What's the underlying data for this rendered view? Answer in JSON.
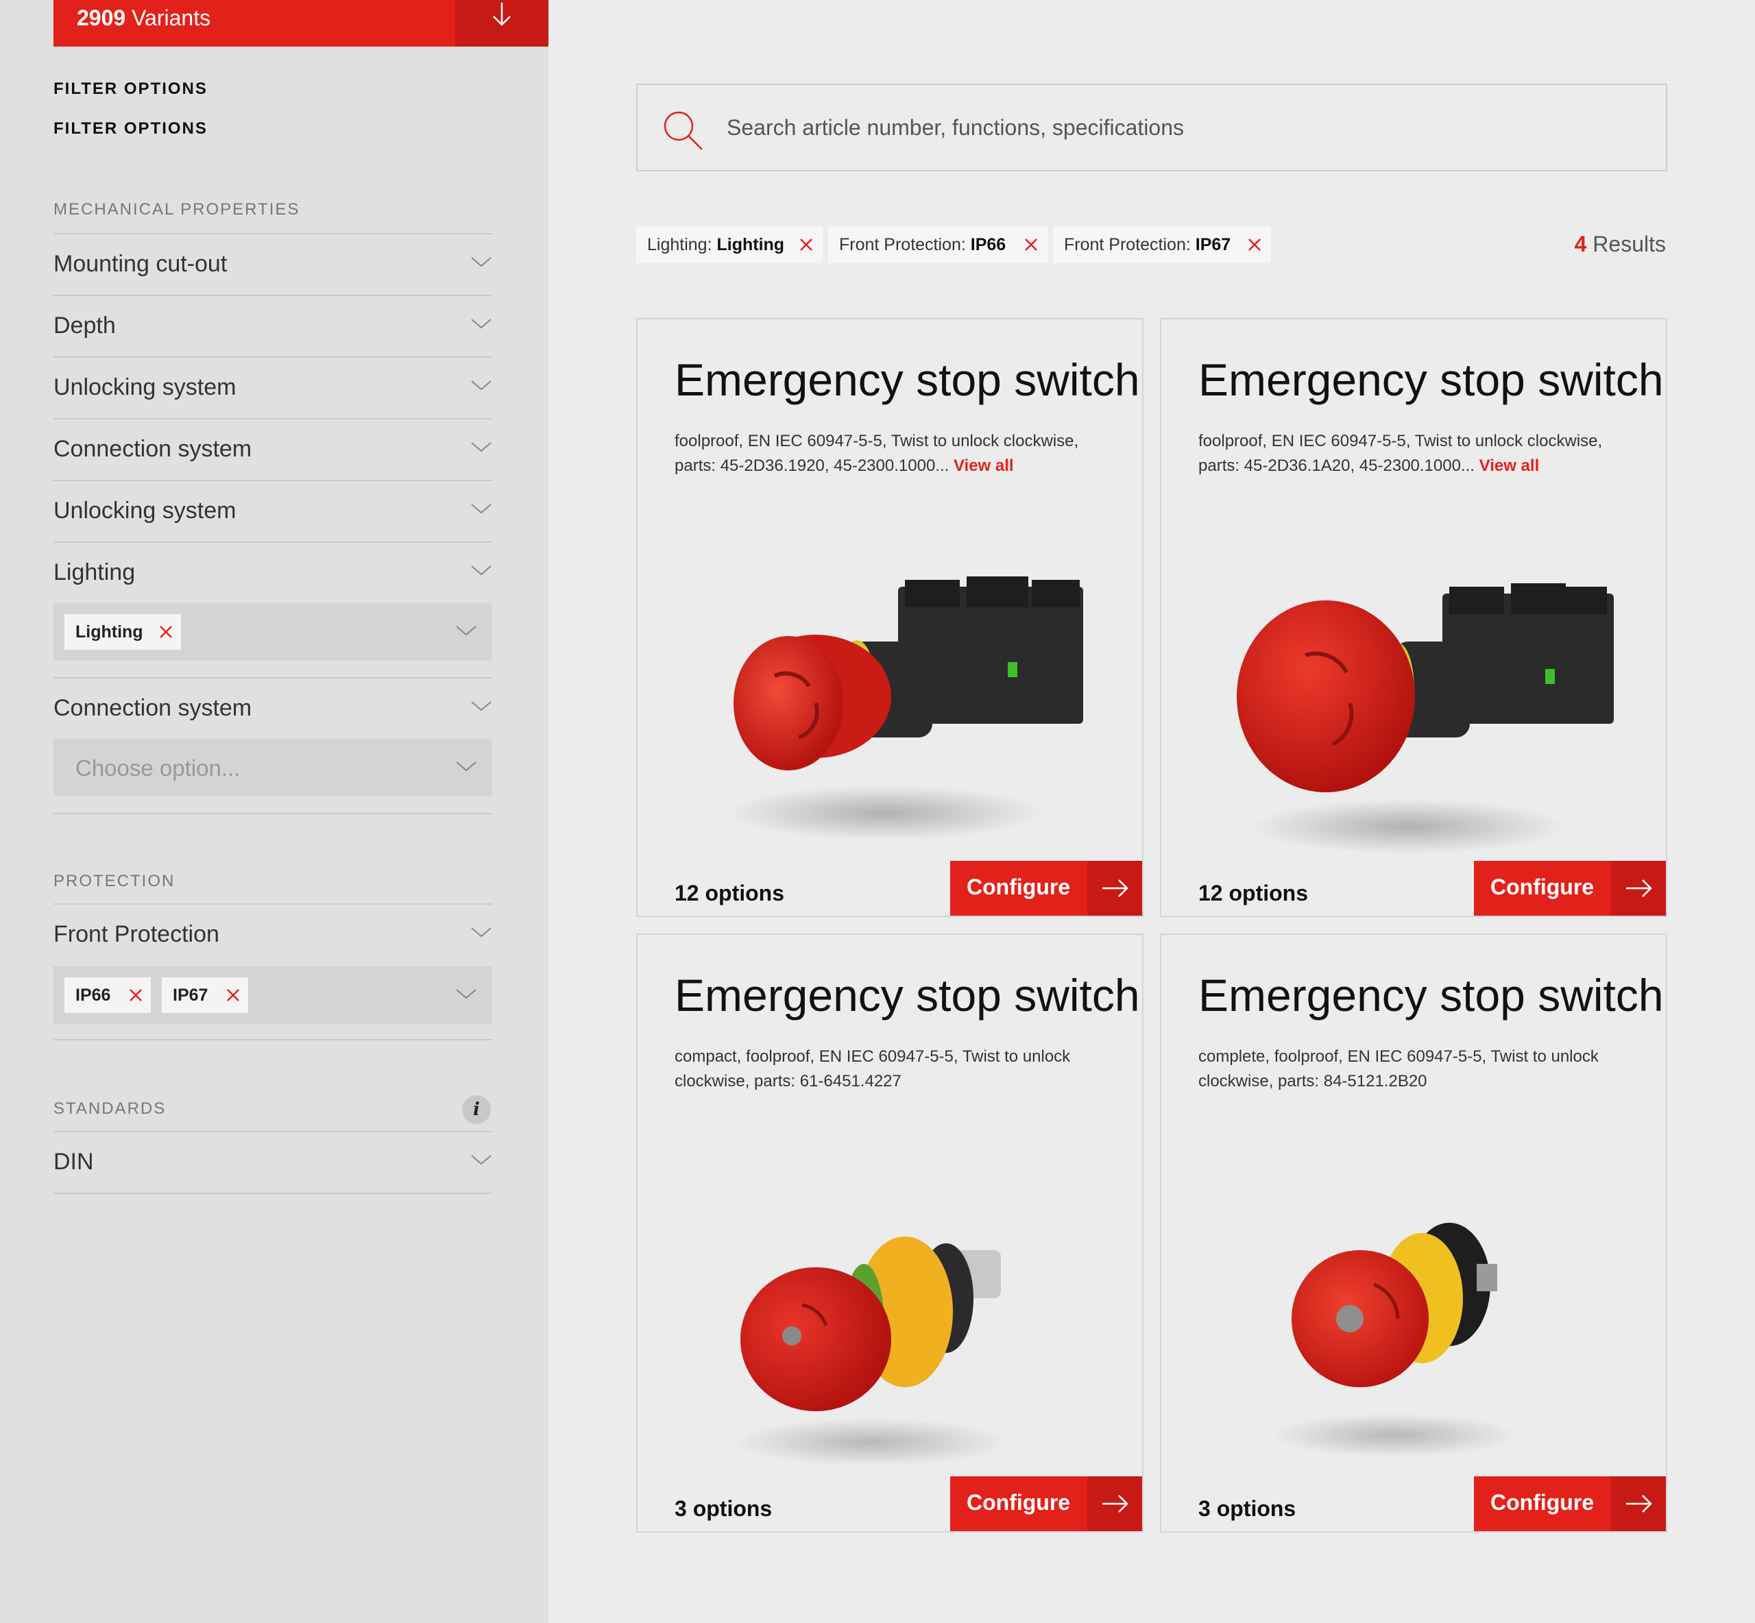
{
  "variants": {
    "count": "2909",
    "label": "Variants"
  },
  "filter_options": [
    "FILTER OPTIONS",
    "FILTER OPTIONS"
  ],
  "sections": {
    "mechanical": "MECHANICAL PROPERTIES",
    "protection": "PROTECTION",
    "standards": "STANDARDS"
  },
  "mechanical_filters": [
    "Mounting cut-out",
    "Depth",
    "Unlocking system",
    "Connection system",
    "Unlocking system",
    "Lighting"
  ],
  "lighting_selected": [
    "Lighting"
  ],
  "connection_filter": {
    "label": "Connection system",
    "placeholder": "Choose option..."
  },
  "protection_filter": {
    "label": "Front Protection",
    "selected": [
      "IP66",
      "IP67"
    ]
  },
  "standards_filter": {
    "label": "DIN",
    "info_icon": "info-icon"
  },
  "search": {
    "placeholder": "Search article number, functions, specifications",
    "value": ""
  },
  "active_tags": [
    {
      "key": "Lighting:",
      "value": "Lighting"
    },
    {
      "key": "Front Protection:",
      "value": "IP66"
    },
    {
      "key": "Front Protection:",
      "value": "IP67"
    }
  ],
  "results": {
    "count": "4",
    "label": "Results"
  },
  "cards": [
    {
      "title": "Emergency stop switch",
      "desc": "foolproof, EN IEC 60947-5-5, Twist to unlock clockwise, parts: 45-2D36.1920, 45-2300.1000...",
      "view_all": "View all",
      "options": "12 options",
      "configure": "Configure"
    },
    {
      "title": "Emergency stop switch",
      "desc": "foolproof, EN IEC 60947-5-5, Twist to unlock clockwise, parts: 45-2D36.1A20, 45-2300.1000...",
      "view_all": "View all",
      "options": "12 options",
      "configure": "Configure"
    },
    {
      "title": "Emergency stop switch",
      "desc": "compact, foolproof, EN IEC 60947-5-5, Twist to unlock clockwise, parts: 61-6451.4227",
      "view_all": "",
      "options": "3 options",
      "configure": "Configure"
    },
    {
      "title": "Emergency stop switch",
      "desc": "complete, foolproof, EN IEC 60947-5-5, Twist to unlock clockwise, parts: 84-5121.2B20",
      "view_all": "",
      "options": "3 options",
      "configure": "Configure"
    }
  ],
  "colors": {
    "accent": "#e3211b",
    "accent_dark": "#c71a15",
    "sidebar_bg": "#e0e0e0",
    "page_bg": "#ececec"
  }
}
